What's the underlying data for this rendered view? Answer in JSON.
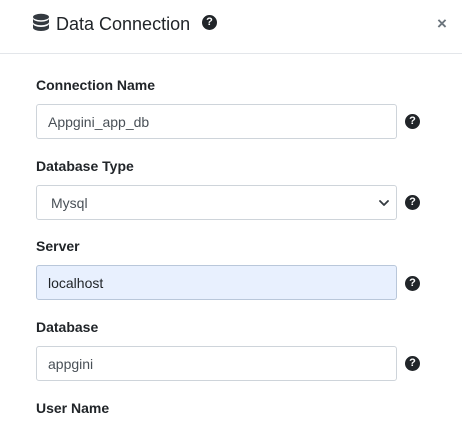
{
  "dialog": {
    "title": "Data Connection",
    "close_glyph": "×",
    "help_glyph": "?",
    "icons": {
      "title": "database-icon",
      "help": "question-circle-icon",
      "close": "close-icon",
      "dropdown": "chevron-down-icon"
    }
  },
  "form": {
    "connection_name": {
      "label": "Connection Name",
      "value": "Appgini_app_db"
    },
    "database_type": {
      "label": "Database Type",
      "value": "Mysql"
    },
    "server": {
      "label": "Server",
      "value": "localhost"
    },
    "database": {
      "label": "Database",
      "value": "appgini"
    },
    "user_name": {
      "label": "User Name"
    }
  }
}
